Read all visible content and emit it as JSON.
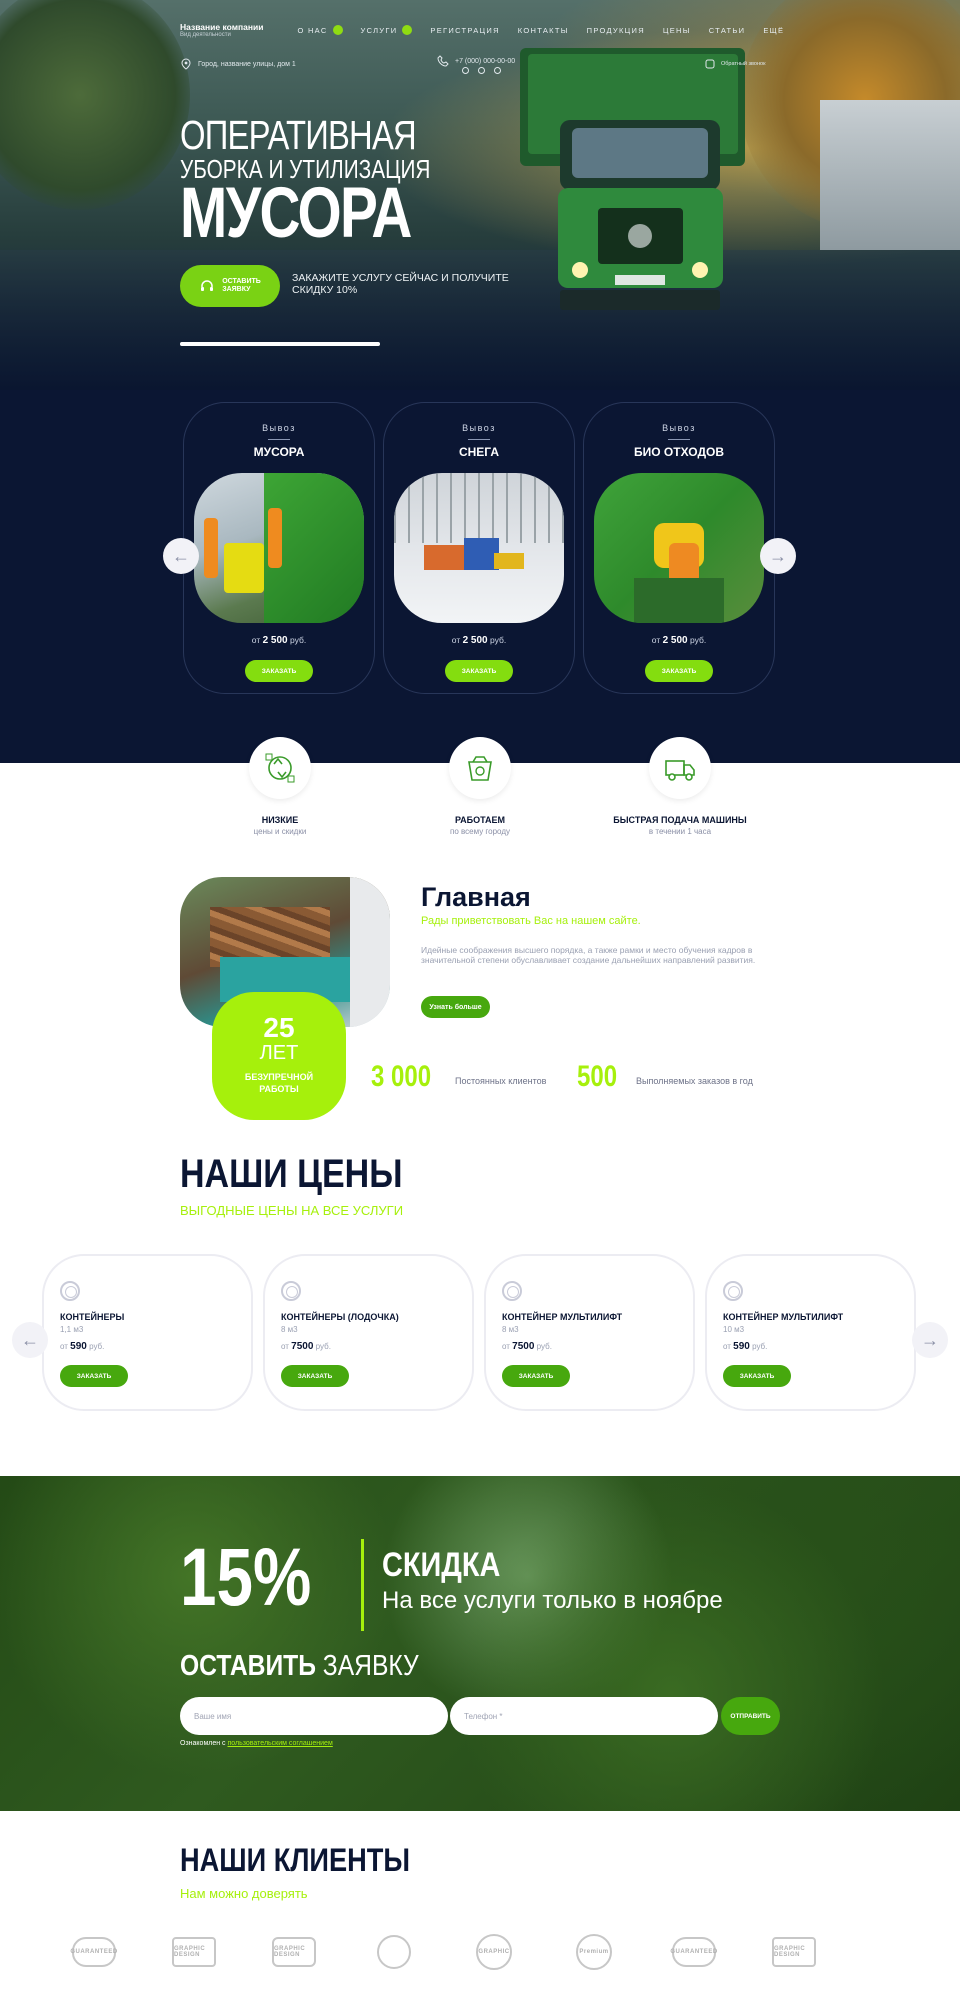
{
  "header": {
    "brand_name": "Название компании",
    "brand_sub": "Вид деятельности",
    "menu": [
      {
        "label": "О НАС"
      },
      {
        "label": "УСЛУГИ"
      },
      {
        "label": "РЕГИСТРАЦИЯ"
      },
      {
        "label": "КОНТАКТЫ"
      },
      {
        "label": "ПРОДУКЦИЯ"
      },
      {
        "label": "ЦЕНЫ"
      },
      {
        "label": "СТАТЬИ"
      },
      {
        "label": "ЕЩЁ"
      }
    ],
    "address": "Город, название улицы, дом 1",
    "phone": "+7 (000) 000-00-00",
    "callback": "Обратный звонок",
    "accent": "#8fdc12"
  },
  "hero": {
    "line1": "ОПЕРАТИВНАЯ",
    "line2": "УБОРКА И УТИЛИЗАЦИЯ",
    "line3": "МУСОРА",
    "cta_label_1": "ОСТАВИТЬ",
    "cta_label_2": "ЗАЯВКУ",
    "cta_note": "ЗАКАЖИТЕ УСЛУГУ СЕЙЧАС И ПОЛУЧИТЕ СКИДКУ 10%",
    "slider_progress": 1.0
  },
  "services": [
    {
      "kicker": "Вывоз",
      "title": "МУСОРА",
      "price_prefix": "от",
      "price": "2 500",
      "price_unit": "руб.",
      "button": "ЗАКАЗАТЬ"
    },
    {
      "kicker": "Вывоз",
      "title": "СНЕГА",
      "price_prefix": "от",
      "price": "2 500",
      "price_unit": "руб.",
      "button": "ЗАКАЗАТЬ"
    },
    {
      "kicker": "Вывоз",
      "title": "БИО ОТХОДОВ",
      "price_prefix": "от",
      "price": "2 500",
      "price_unit": "руб.",
      "button": "ЗАКАЗАТЬ"
    }
  ],
  "features": [
    {
      "title": "НИЗКИЕ",
      "sub": "цены и скидки",
      "icon": "recycle-icon"
    },
    {
      "title": "РАБОТАЕМ",
      "sub": "по всему городу",
      "icon": "dumpster-icon"
    },
    {
      "title": "БЫСТРАЯ ПОДАЧА МАШИНЫ",
      "sub": "в течении 1 часа",
      "icon": "truck-icon"
    }
  ],
  "about": {
    "title": "Главная",
    "subtitle": "Рады приветствовать Вас на нашем сайте.",
    "text": "Идейные соображения высшего порядка, а также рамки и место обучения кадров в значительной степени обуславливает создание дальнейших направлений развития.",
    "button": "Узнать больше",
    "years_number": "25",
    "years_label": "ЛЕТ",
    "years_desc_1": "БЕЗУПРЕЧНОЙ",
    "years_desc_2": "РАБОТЫ",
    "stat1_value": "3 000",
    "stat1_label": "Постоянных клиентов",
    "stat2_value": "500",
    "stat2_label": "Выполняемых заказов в год"
  },
  "prices": {
    "title": "НАШИ ЦЕНЫ",
    "subtitle": "ВЫГОДНЫЕ ЦЕНЫ НА ВСЕ УСЛУГИ",
    "items": [
      {
        "name": "КОНТЕЙНЕРЫ",
        "volume": "1,1 м3",
        "prefix": "от",
        "price": "590",
        "unit": "руб.",
        "button": "ЗАКАЗАТЬ"
      },
      {
        "name": "КОНТЕЙНЕРЫ (ЛОДОЧКА)",
        "volume": "8 м3",
        "prefix": "от",
        "price": "7500",
        "unit": "руб.",
        "button": "ЗАКАЗАТЬ"
      },
      {
        "name": "КОНТЕЙНЕР МУЛЬТИЛИФТ",
        "volume": "8 м3",
        "prefix": "от",
        "price": "7500",
        "unit": "руб.",
        "button": "ЗАКАЗАТЬ"
      },
      {
        "name": "КОНТЕЙНЕР МУЛЬТИЛИФТ",
        "volume": "10 м3",
        "prefix": "от",
        "price": "590",
        "unit": "руб.",
        "button": "ЗАКАЗАТЬ"
      }
    ]
  },
  "promo": {
    "percent": "15%",
    "title": "СКИДКА",
    "subtitle": "На все услуги только в ноябре",
    "form_title_bold": "ОСТАВИТЬ",
    "form_title_rest": " ЗАЯВКУ",
    "name_placeholder": "Ваше имя",
    "phone_placeholder": "Телефон *",
    "send_label": "ОТПРАВИТЬ",
    "agree_text": "Ознакомлен с ",
    "agree_link": "пользовательским соглашением"
  },
  "clients": {
    "title": "НАШИ КЛИЕНТЫ",
    "subtitle": "Нам можно доверять",
    "logos": [
      "GUARANTEED",
      "GRAPHIC DESIGN",
      "GRAPHIC DESIGN",
      "",
      "GRAPHIC",
      "Premium",
      "GUARANTEED",
      "GRAPHIC DESIGN"
    ]
  }
}
